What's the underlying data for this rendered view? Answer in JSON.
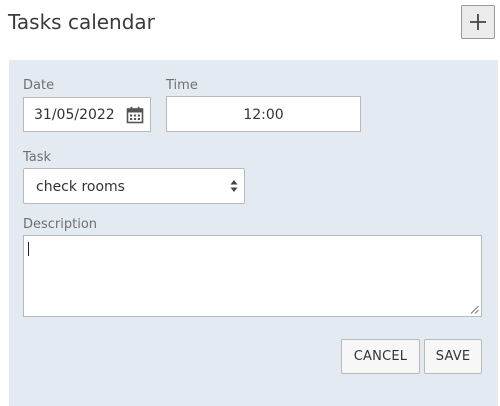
{
  "header": {
    "title": "Tasks calendar",
    "add_icon": "plus-icon"
  },
  "form": {
    "date": {
      "label": "Date",
      "value": "31/05/2022",
      "icon": "calendar-icon"
    },
    "time": {
      "label": "Time",
      "value": "12:00"
    },
    "task": {
      "label": "Task",
      "value": "check rooms",
      "icon": "select-arrows-icon"
    },
    "description": {
      "label": "Description",
      "value": ""
    },
    "cancel_label": "CANCEL",
    "save_label": "SAVE"
  },
  "colors": {
    "panel_background": "#e4eaf2",
    "border": "#b9b9b9",
    "button_background": "#f7f7f7"
  }
}
